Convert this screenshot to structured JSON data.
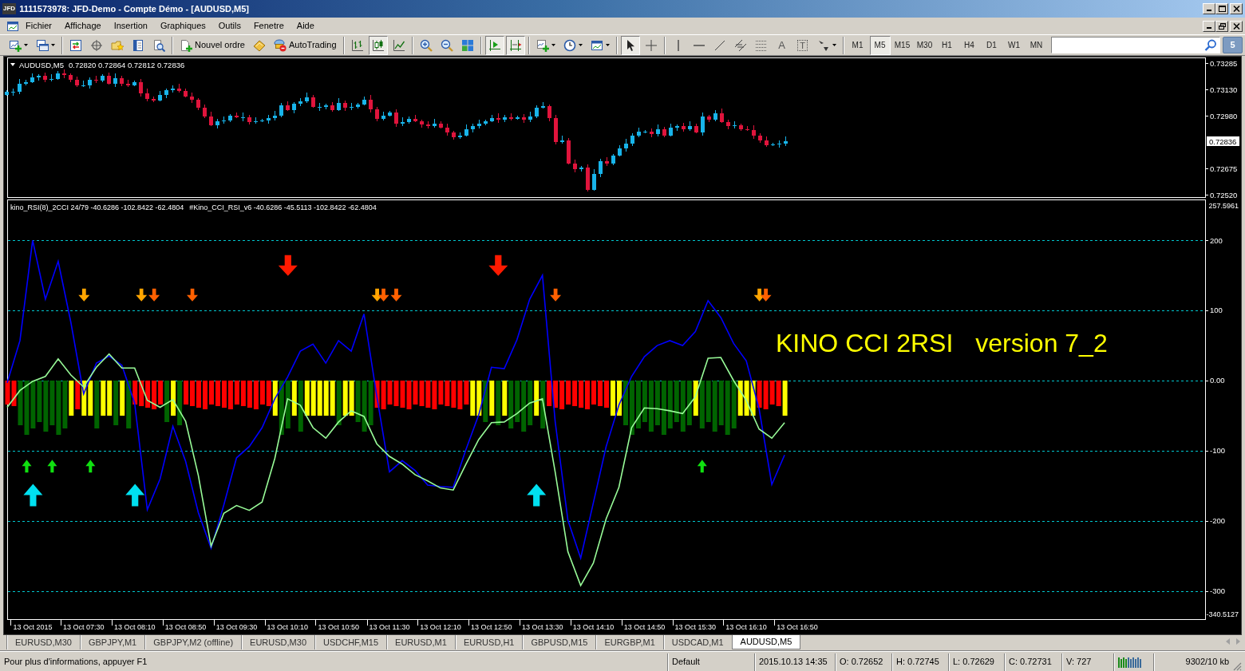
{
  "window": {
    "badge": "JFD",
    "title": "1111573978: JFD-Demo - Compte Démo - [AUDUSD,M5]"
  },
  "menu": [
    "Fichier",
    "Affichage",
    "Insertion",
    "Graphiques",
    "Outils",
    "Fenetre",
    "Aide"
  ],
  "toolbar": {
    "order_button": "Nouvel ordre",
    "autotrading_button": "AutoTrading",
    "chart_types": [
      {
        "selected": false
      },
      {
        "selected": true
      },
      {
        "selected": false
      }
    ],
    "scroll_toggles": [
      {
        "selected": true
      },
      {
        "selected": true
      }
    ],
    "pointer_tools": [
      {
        "selected": true
      },
      {
        "selected": false
      }
    ],
    "text_tool": "A",
    "label_tool": "T",
    "timeframes": [
      {
        "label": "M1",
        "selected": false
      },
      {
        "label": "M5",
        "selected": true
      },
      {
        "label": "M15",
        "selected": false
      },
      {
        "label": "M30",
        "selected": false
      },
      {
        "label": "H1",
        "selected": false
      },
      {
        "label": "H4",
        "selected": false
      },
      {
        "label": "D1",
        "selected": false
      },
      {
        "label": "W1",
        "selected": false
      },
      {
        "label": "MN",
        "selected": false
      }
    ],
    "message_count": "5"
  },
  "chart": {
    "price_pane": {
      "symbol": "AUDUSD,M5",
      "ohlc": "0.72820 0.72864 0.72812 0.72836",
      "price_ticks": [
        "0.73285",
        "0.73130",
        "0.72980",
        "0.72675",
        "0.72520"
      ],
      "current_price": "0.72836"
    },
    "indicator_pane": {
      "labels": [
        "kino_RSI(8)_2CCI 24/79 -40.6286 -102.8422 -62.4804",
        "#Kino_CCI_RSI_v6 -40.6286 -45.5113 -102.8422 -62.4804"
      ],
      "caption": [
        "KINO CCI 2RSI",
        "version 7_2"
      ],
      "scale_max": "257.5961",
      "scale_min": "-340.5127",
      "chart_data": {
        "type": "line",
        "categories": [
          null,
          null,
          "13 Oct 2015",
          null,
          null,
          null,
          "13 Oct 07:30",
          null,
          null,
          null,
          "13 Oct 08:10",
          null,
          null,
          null,
          "13 Oct 08:50",
          null,
          null,
          null,
          "13 Oct 09:30",
          null,
          null,
          null,
          "13 Oct 10:10",
          null,
          null,
          null,
          "13 Oct 10:50",
          null,
          null,
          null,
          "13 Oct 11:30",
          null,
          null,
          null,
          "13 Oct 12:10",
          null,
          null,
          null,
          "13 Oct 12:50",
          null,
          null,
          null,
          "13 Oct 13:30",
          null,
          null,
          null,
          "13 Oct 14:10",
          null,
          null,
          null,
          "13 Oct 14:50",
          null,
          null,
          null,
          "13 Oct 15:30",
          null,
          null,
          null,
          "13 Oct 16:10",
          null,
          null,
          null,
          "13 Oct 16:50",
          null,
          null,
          null,
          null,
          null,
          null,
          null,
          null,
          null,
          null,
          null,
          null,
          null,
          null,
          null,
          null,
          null,
          null,
          null,
          null,
          null,
          null,
          null,
          null,
          null,
          null,
          null,
          null,
          null,
          null,
          null
        ],
        "series": [
          {
            "color": "#0000ff",
            "values": [
              -3,
              57,
              200,
              116,
              170,
              83,
              -19,
              25,
              35,
              22,
              -32,
              -184,
              -140,
              -65,
              -115,
              -188,
              -239,
              -177,
              -110,
              -94,
              -67,
              -26,
              5,
              42,
              52,
              25,
              57,
              42,
              95,
              -22,
              -130,
              -114,
              -128,
              -149,
              -151,
              -152,
              -98,
              -49,
              19,
              17,
              58,
              116,
              150,
              -58,
              -199,
              -253,
              -174,
              -94,
              -35,
              6,
              34,
              50,
              57,
              50,
              70,
              114,
              90,
              53,
              28,
              -40,
              -148,
              -106,
              null,
              null,
              null,
              null,
              null,
              null,
              null,
              null,
              null,
              null,
              null,
              null,
              null,
              null,
              null,
              null,
              null,
              null,
              null,
              null,
              null,
              null,
              null,
              null,
              null,
              null,
              null,
              null,
              null,
              null,
              null,
              null
            ]
          },
          {
            "color": "#98fb98",
            "values": [
              -38,
              -14,
              -1,
              6,
              31,
              8,
              -9,
              19,
              38,
              18,
              18,
              -28,
              -38,
              -27,
              -58,
              -135,
              -236,
              -189,
              -178,
              -185,
              -173,
              -111,
              -26,
              -35,
              -67,
              -82,
              -59,
              -43,
              -51,
              -90,
              -108,
              -119,
              -134,
              -143,
              -153,
              -156,
              -119,
              -84,
              -60,
              -59,
              -47,
              -32,
              -26,
              -130,
              -244,
              -292,
              -260,
              -197,
              -152,
              -67,
              -39,
              -40,
              -43,
              -47,
              -23,
              32,
              33,
              0,
              -28,
              -69,
              -82,
              -60,
              null,
              null,
              null,
              null,
              null,
              null,
              null,
              null,
              null,
              null,
              null,
              null,
              null,
              null,
              null,
              null,
              null,
              null,
              null,
              null,
              null,
              null,
              null,
              null,
              null,
              null,
              null,
              null,
              null,
              null,
              null,
              null
            ]
          }
        ],
        "ylim": [
          -340.5127,
          257.5961
        ],
        "yticks": [
          {
            "value": 200,
            "label": "200"
          },
          {
            "value": 100,
            "label": "100"
          },
          {
            "value": 0,
            "label": "0.00"
          },
          {
            "value": -100,
            "label": "-100"
          },
          {
            "value": -200,
            "label": "-200"
          },
          {
            "value": -300,
            "label": "-300"
          }
        ],
        "grid": true
      }
    }
  },
  "tabs": [
    {
      "label": "EURUSD,M30",
      "selected": false
    },
    {
      "label": "GBPJPY,M1",
      "selected": false
    },
    {
      "label": "GBPJPY,M2 (offline)",
      "selected": false
    },
    {
      "label": "EURUSD,M30",
      "selected": false
    },
    {
      "label": "USDCHF,M15",
      "selected": false
    },
    {
      "label": "EURUSD,M1",
      "selected": false
    },
    {
      "label": "EURUSD,H1",
      "selected": false
    },
    {
      "label": "GBPUSD,M15",
      "selected": false
    },
    {
      "label": "EURGBP,M1",
      "selected": false
    },
    {
      "label": "USDCAD,M1",
      "selected": false
    },
    {
      "label": "AUDUSD,M5",
      "selected": true
    }
  ],
  "status_bar": {
    "help": "Pour plus d'informations, appuyer F1",
    "profile": "Default",
    "datetime": "2015.10.13 14:35",
    "open": "O: 0.72652",
    "high": "H: 0.72745",
    "low": "L: 0.72629",
    "close": "C: 0.72731",
    "volume": "V: 727",
    "traffic": "9302/10 kb"
  }
}
